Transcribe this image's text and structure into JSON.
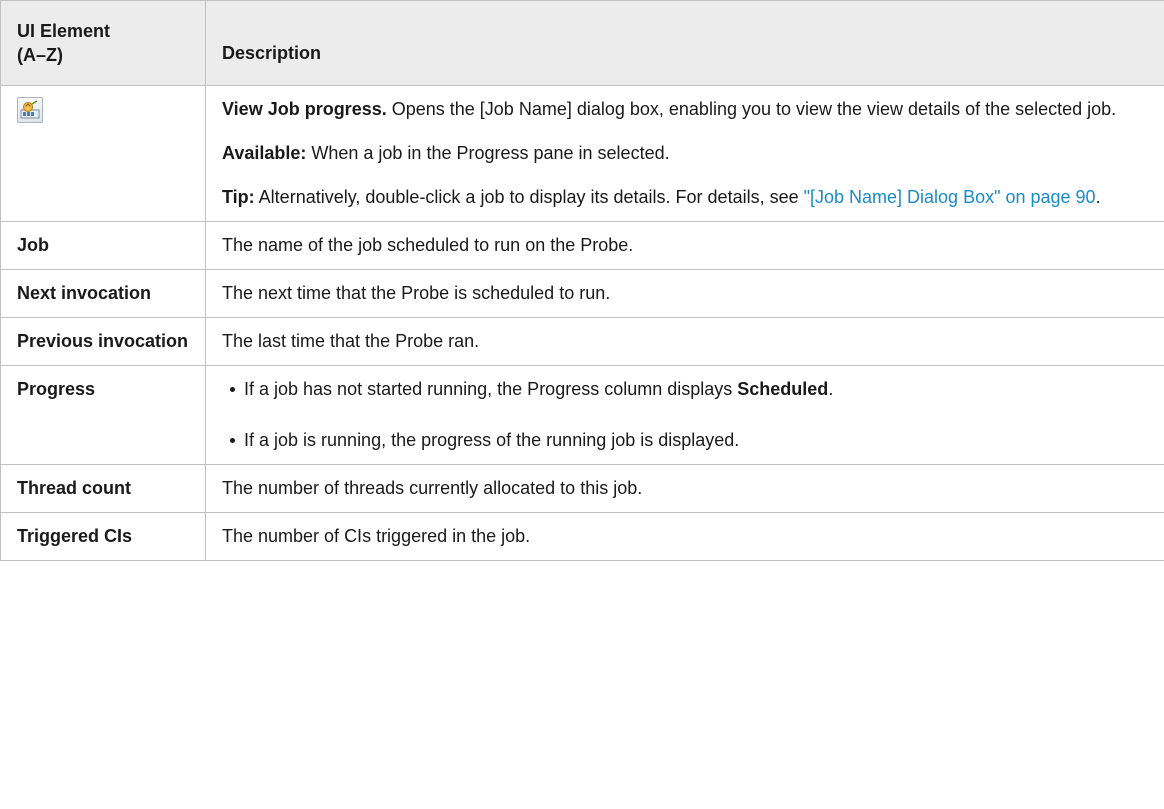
{
  "header": {
    "col1_line1": "UI Element",
    "col1_line2": "(A–Z)",
    "col2": "Description"
  },
  "rows": {
    "view_job": {
      "icon": "view-job-progress-icon",
      "title": "View Job progress.",
      "desc": " Opens the [Job Name] dialog box, enabling you to view the view details of the selected job.",
      "available_label": "Available:",
      "available_text": " When a job in the Progress pane in selected.",
      "tip_label": "Tip:",
      "tip_text": " Alternatively, double-click a job to display its details. For details, see ",
      "tip_link": "\"[Job Name] Dialog Box\" on page 90",
      "tip_end": "."
    },
    "job": {
      "name": "Job",
      "desc": "The name of the job scheduled to run on the Probe."
    },
    "next_invocation": {
      "name": "Next invocation",
      "desc": "The next time that the Probe is scheduled to run."
    },
    "previous_invocation": {
      "name": "Previous invocation",
      "desc": "The last time that the Probe ran."
    },
    "progress": {
      "name": "Progress",
      "bullet1": "If a job has not started running, the Progress column displays ",
      "bullet1_bold": "Scheduled",
      "bullet1_end": ".",
      "bullet2": "If a job is running, the progress of the running job is displayed."
    },
    "thread_count": {
      "name": "Thread count",
      "desc": "The number of threads currently allocated to this job."
    },
    "triggered_cis": {
      "name": "Triggered CIs",
      "desc": "The number of CIs triggered in the job."
    }
  }
}
